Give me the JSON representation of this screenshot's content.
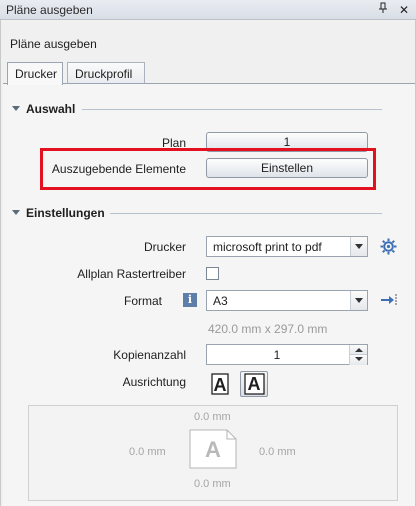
{
  "window": {
    "title": "Pläne ausgeben",
    "pin_glyph": "📌",
    "close_glyph": "✕"
  },
  "panel": {
    "title": "Pläne ausgeben"
  },
  "tabs": [
    {
      "label": "Drucker"
    },
    {
      "label": "Druckprofil"
    }
  ],
  "auswahl": {
    "heading": "Auswahl",
    "plan_label": "Plan",
    "plan_value": "1",
    "elemente_label": "Auszugebende Elemente",
    "elemente_button": "Einstellen"
  },
  "einstellungen": {
    "heading": "Einstellungen",
    "drucker_label": "Drucker",
    "drucker_value": "microsoft print to pdf",
    "raster_label": "Allplan Rastertreiber",
    "raster_checked": false,
    "format_label": "Format",
    "format_value": "A3",
    "format_size": "420.0 mm x 297.0 mm",
    "kopien_label": "Kopienanzahl",
    "kopien_value": "1",
    "ausrichtung_label": "Ausrichtung",
    "ausrichtung_glyph": "A"
  },
  "preview": {
    "top": "0.0 mm",
    "left": "0.0 mm",
    "right": "0.0 mm",
    "bottom": "0.0 mm",
    "page_glyph": "A"
  },
  "colors": {
    "highlight": "#e3101f",
    "accent": "#3d6fb4"
  }
}
